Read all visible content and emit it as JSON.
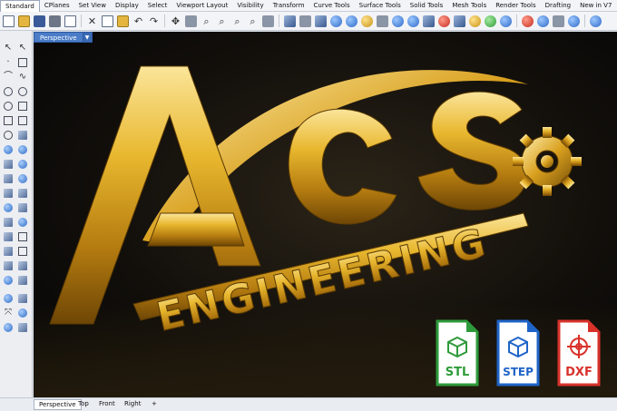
{
  "tabs": [
    "Standard",
    "CPlanes",
    "Set View",
    "Display",
    "Select",
    "Viewport Layout",
    "Visibility",
    "Transform",
    "Curve Tools",
    "Surface Tools",
    "Solid Tools",
    "Mesh Tools",
    "Render Tools",
    "Drafting",
    "New in V7"
  ],
  "viewport": {
    "title": "Perspective"
  },
  "logo": {
    "brand": "ACS",
    "tagline": "ENGINEERING"
  },
  "file_badges": [
    {
      "label": "STL",
      "color": "#2e9b3a"
    },
    {
      "label": "STEP",
      "color": "#1f64c8"
    },
    {
      "label": "DXF",
      "color": "#d8322b"
    }
  ],
  "viewport_tabs": [
    "Perspective",
    "Top",
    "Front",
    "Right"
  ],
  "add_tab_label": "+",
  "colors": {
    "gold_light": "#f7d565",
    "gold_mid": "#d8a21c",
    "gold_dark": "#7a5208",
    "accent_blue": "#4a7cc7"
  }
}
